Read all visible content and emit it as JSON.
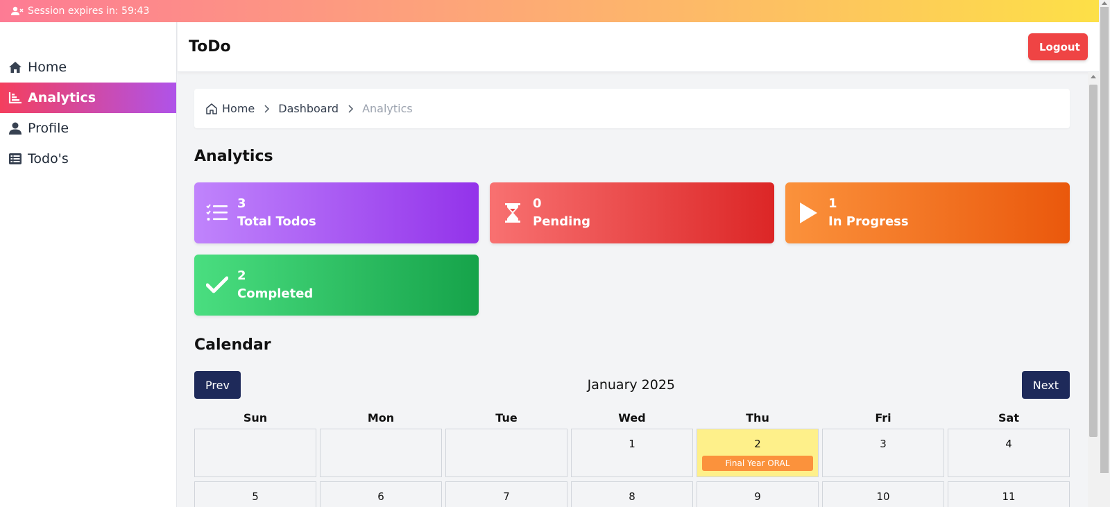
{
  "session": {
    "text": "Session expires in: 59:43"
  },
  "sidebar": {
    "items": [
      {
        "label": "Home",
        "icon": "home-icon"
      },
      {
        "label": "Analytics",
        "icon": "chart-icon",
        "active": true
      },
      {
        "label": "Profile",
        "icon": "user-icon"
      },
      {
        "label": "Todo's",
        "icon": "list-icon"
      }
    ]
  },
  "header": {
    "title": "ToDo",
    "logout_label": "Logout"
  },
  "breadcrumb": {
    "home": "Home",
    "dashboard": "Dashboard",
    "current": "Analytics"
  },
  "analytics": {
    "title": "Analytics",
    "stats": [
      {
        "value": "3",
        "label": "Total Todos",
        "color": "#9333ea"
      },
      {
        "value": "0",
        "label": "Pending",
        "color": "#dc2626"
      },
      {
        "value": "1",
        "label": "In Progress",
        "color": "#ea580c"
      },
      {
        "value": "2",
        "label": "Completed",
        "color": "#16a34a"
      }
    ]
  },
  "calendar": {
    "title": "Calendar",
    "prev_label": "Prev",
    "next_label": "Next",
    "month": "January 2025",
    "weekdays": [
      "Sun",
      "Mon",
      "Tue",
      "Wed",
      "Thu",
      "Fri",
      "Sat"
    ],
    "week1": [
      "",
      "",
      "",
      "1",
      "2",
      "3",
      "4"
    ],
    "week2": [
      "5",
      "6",
      "7",
      "8",
      "9",
      "10",
      "11"
    ],
    "event": {
      "day": "2",
      "title": "Final Year ORAL"
    }
  }
}
